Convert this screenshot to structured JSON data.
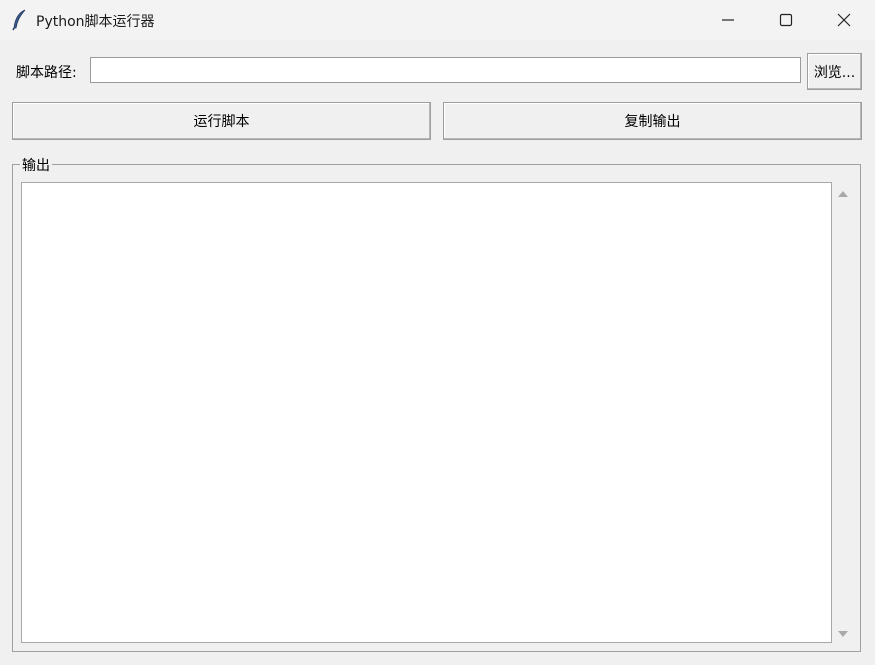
{
  "window": {
    "title": "Python脚本运行器",
    "app_icon": "feather-icon"
  },
  "form": {
    "path_label": "脚本路径:",
    "path_value": "",
    "browse_label": "浏览..."
  },
  "actions": {
    "run_label": "运行脚本",
    "copy_label": "复制输出"
  },
  "output": {
    "legend": "输出",
    "text": ""
  }
}
